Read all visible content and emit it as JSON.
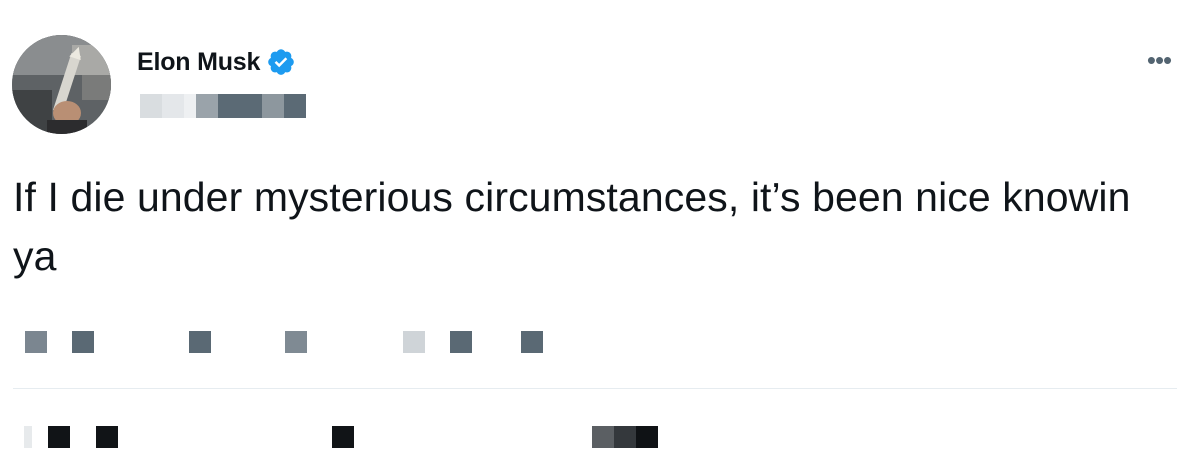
{
  "author": {
    "display_name": "Elon Musk",
    "verified": true,
    "verified_color": "#1d9bf0",
    "avatar_icon": "profile-photo",
    "handle_pixelated": true
  },
  "menu": {
    "more_label": "•••"
  },
  "tweet": {
    "text": "If I die under mysterious circumstances, it’s been nice knowin ya"
  },
  "metadata": {
    "pixelated": true
  },
  "actions": {
    "pixelated": true
  },
  "colors": {
    "text": "#0f1419",
    "secondary": "#536471",
    "divider": "#e6ecf0"
  }
}
